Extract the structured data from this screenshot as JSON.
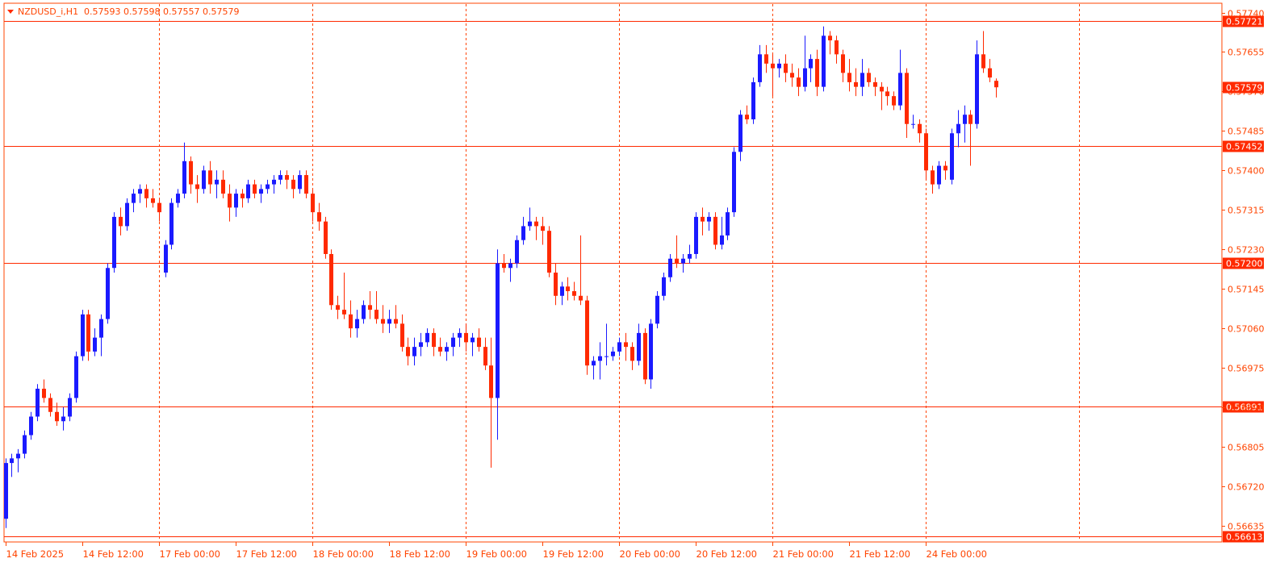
{
  "header": {
    "symbol_timeframe": "NZDUSD_i,H1",
    "ohlc": "0.57593 0.57598 0.57557 0.57579"
  },
  "colors": {
    "background": "#ffffff",
    "frame": "#ff4400",
    "bull": "#1a1aff",
    "bear": "#ff2a00",
    "level_line": "#ff2a00",
    "separator": "#ff4400",
    "tag_bg": "#ff2a00",
    "tag_text": "#ffffff",
    "axis_text": "#ff4400"
  },
  "chart_data": {
    "type": "candlestick",
    "symbol": "NZDUSD_i",
    "timeframe": "H1",
    "ylim": [
      0.566,
      0.5776
    ],
    "y_ticks": [
      "0.57740",
      "0.57655",
      "0.57570",
      "0.57485",
      "0.57400",
      "0.57315",
      "0.57230",
      "0.57145",
      "0.57060",
      "0.56975",
      "0.56890",
      "0.56805",
      "0.56720",
      "0.56635"
    ],
    "x_tick_labels": [
      {
        "label": "14 Feb 2025",
        "bar": 0
      },
      {
        "label": "14 Feb 12:00",
        "bar": 12
      },
      {
        "label": "17 Feb 00:00",
        "bar": 24
      },
      {
        "label": "17 Feb 12:00",
        "bar": 36
      },
      {
        "label": "18 Feb 00:00",
        "bar": 48
      },
      {
        "label": "18 Feb 12:00",
        "bar": 60
      },
      {
        "label": "19 Feb 00:00",
        "bar": 72
      },
      {
        "label": "19 Feb 12:00",
        "bar": 84
      },
      {
        "label": "20 Feb 00:00",
        "bar": 96
      },
      {
        "label": "20 Feb 12:00",
        "bar": 108
      },
      {
        "label": "21 Feb 00:00",
        "bar": 120
      },
      {
        "label": "21 Feb 12:00",
        "bar": 132
      },
      {
        "label": "24 Feb 00:00",
        "bar": 144
      }
    ],
    "day_separators": [
      24,
      48,
      72,
      96,
      120,
      144,
      168
    ],
    "horizontal_levels": [
      {
        "price": 0.57721,
        "label": "0.57721"
      },
      {
        "price": 0.57452,
        "label": "0.57452"
      },
      {
        "price": 0.572,
        "label": "0.57200"
      },
      {
        "price": 0.56891,
        "label": "0.56891"
      },
      {
        "price": 0.56613,
        "label": "0.56613"
      }
    ],
    "current_price": {
      "price": 0.57579,
      "label": "0.57579"
    },
    "candles": [
      [
        0.5665,
        0.5678,
        0.5663,
        0.5677
      ],
      [
        0.5677,
        0.5679,
        0.5674,
        0.5678
      ],
      [
        0.5678,
        0.568,
        0.5675,
        0.5679
      ],
      [
        0.5679,
        0.5684,
        0.5678,
        0.5683
      ],
      [
        0.5683,
        0.5688,
        0.5682,
        0.5687
      ],
      [
        0.5687,
        0.5694,
        0.5686,
        0.5693
      ],
      [
        0.5693,
        0.5695,
        0.569,
        0.5691
      ],
      [
        0.5691,
        0.5692,
        0.5687,
        0.5688
      ],
      [
        0.5688,
        0.569,
        0.5685,
        0.5686
      ],
      [
        0.5686,
        0.5689,
        0.5684,
        0.5687
      ],
      [
        0.5687,
        0.5692,
        0.5686,
        0.5691
      ],
      [
        0.5691,
        0.5701,
        0.569,
        0.57
      ],
      [
        0.57,
        0.571,
        0.5699,
        0.5709
      ],
      [
        0.5709,
        0.571,
        0.5699,
        0.5701
      ],
      [
        0.5701,
        0.5706,
        0.57,
        0.5704
      ],
      [
        0.5704,
        0.5709,
        0.57,
        0.5708
      ],
      [
        0.5708,
        0.572,
        0.5707,
        0.5719
      ],
      [
        0.5719,
        0.5731,
        0.5718,
        0.573
      ],
      [
        0.573,
        0.5732,
        0.5726,
        0.5728
      ],
      [
        0.5728,
        0.5734,
        0.5727,
        0.5733
      ],
      [
        0.5733,
        0.5736,
        0.5731,
        0.5735
      ],
      [
        0.5735,
        0.5737,
        0.5733,
        0.5736
      ],
      [
        0.5736,
        0.5737,
        0.5732,
        0.5734
      ],
      [
        0.5734,
        0.5736,
        0.5732,
        0.5733
      ],
      [
        0.5733,
        0.5734,
        0.5729,
        0.5731
      ],
      [
        0.5718,
        0.5725,
        0.5717,
        0.5724
      ],
      [
        0.5724,
        0.5734,
        0.5723,
        0.5733
      ],
      [
        0.5733,
        0.5736,
        0.5732,
        0.5735
      ],
      [
        0.5735,
        0.5746,
        0.5734,
        0.5742
      ],
      [
        0.5742,
        0.5743,
        0.5735,
        0.5737
      ],
      [
        0.5737,
        0.5739,
        0.5733,
        0.5736
      ],
      [
        0.5736,
        0.5741,
        0.5735,
        0.574
      ],
      [
        0.574,
        0.5742,
        0.5735,
        0.5737
      ],
      [
        0.5737,
        0.574,
        0.5734,
        0.5738
      ],
      [
        0.5738,
        0.574,
        0.5734,
        0.5735
      ],
      [
        0.5735,
        0.5737,
        0.5729,
        0.5732
      ],
      [
        0.5732,
        0.5736,
        0.573,
        0.5735
      ],
      [
        0.5735,
        0.5736,
        0.5732,
        0.5734
      ],
      [
        0.5734,
        0.5738,
        0.5733,
        0.5737
      ],
      [
        0.5737,
        0.5738,
        0.5734,
        0.5735
      ],
      [
        0.5735,
        0.5737,
        0.5733,
        0.5736
      ],
      [
        0.5736,
        0.5738,
        0.5735,
        0.5737
      ],
      [
        0.5737,
        0.5739,
        0.5735,
        0.5738
      ],
      [
        0.5738,
        0.574,
        0.5737,
        0.5739
      ],
      [
        0.5739,
        0.574,
        0.5736,
        0.5738
      ],
      [
        0.5738,
        0.5739,
        0.5734,
        0.5736
      ],
      [
        0.5736,
        0.574,
        0.5735,
        0.5739
      ],
      [
        0.5739,
        0.574,
        0.5734,
        0.5735
      ],
      [
        0.5735,
        0.5736,
        0.5729,
        0.5731
      ],
      [
        0.5731,
        0.5733,
        0.5727,
        0.5729
      ],
      [
        0.5729,
        0.573,
        0.5721,
        0.5722
      ],
      [
        0.5722,
        0.5723,
        0.571,
        0.5711
      ],
      [
        0.5711,
        0.5713,
        0.5708,
        0.571
      ],
      [
        0.571,
        0.5718,
        0.5708,
        0.5709
      ],
      [
        0.5709,
        0.5712,
        0.5704,
        0.5706
      ],
      [
        0.5706,
        0.571,
        0.5704,
        0.5708
      ],
      [
        0.5708,
        0.5712,
        0.5707,
        0.5711
      ],
      [
        0.5711,
        0.5714,
        0.5708,
        0.571
      ],
      [
        0.571,
        0.5714,
        0.5707,
        0.5708
      ],
      [
        0.5708,
        0.5711,
        0.5705,
        0.5707
      ],
      [
        0.5707,
        0.571,
        0.5705,
        0.5708
      ],
      [
        0.5708,
        0.5711,
        0.5706,
        0.5707
      ],
      [
        0.5707,
        0.5709,
        0.5701,
        0.5702
      ],
      [
        0.5702,
        0.5704,
        0.5698,
        0.57
      ],
      [
        0.57,
        0.5704,
        0.5698,
        0.5702
      ],
      [
        0.5702,
        0.5705,
        0.57,
        0.5703
      ],
      [
        0.5703,
        0.5706,
        0.5702,
        0.5705
      ],
      [
        0.5705,
        0.5706,
        0.57,
        0.5702
      ],
      [
        0.5702,
        0.5704,
        0.57,
        0.5701
      ],
      [
        0.5701,
        0.5703,
        0.5699,
        0.5702
      ],
      [
        0.5702,
        0.5705,
        0.57,
        0.5704
      ],
      [
        0.5704,
        0.5706,
        0.5702,
        0.5705
      ],
      [
        0.5705,
        0.5707,
        0.5701,
        0.5703
      ],
      [
        0.5703,
        0.5705,
        0.57,
        0.5704
      ],
      [
        0.5704,
        0.5706,
        0.5701,
        0.5702
      ],
      [
        0.5702,
        0.5704,
        0.5697,
        0.5698
      ],
      [
        0.5698,
        0.5704,
        0.5676,
        0.5691
      ],
      [
        0.5691,
        0.5723,
        0.5682,
        0.572
      ],
      [
        0.572,
        0.5722,
        0.5718,
        0.5719
      ],
      [
        0.5719,
        0.5721,
        0.5716,
        0.572
      ],
      [
        0.572,
        0.5726,
        0.5719,
        0.5725
      ],
      [
        0.5725,
        0.573,
        0.5724,
        0.5728
      ],
      [
        0.5728,
        0.5732,
        0.5727,
        0.5729
      ],
      [
        0.5729,
        0.573,
        0.5725,
        0.5728
      ],
      [
        0.5728,
        0.573,
        0.5724,
        0.5727
      ],
      [
        0.5727,
        0.5728,
        0.5717,
        0.5718
      ],
      [
        0.5718,
        0.572,
        0.5711,
        0.5713
      ],
      [
        0.5713,
        0.5716,
        0.5711,
        0.5715
      ],
      [
        0.5715,
        0.5717,
        0.5712,
        0.5714
      ],
      [
        0.5714,
        0.5716,
        0.5712,
        0.5713
      ],
      [
        0.5713,
        0.5726,
        0.5711,
        0.5712
      ],
      [
        0.5712,
        0.5713,
        0.5696,
        0.5698
      ],
      [
        0.5698,
        0.57,
        0.5695,
        0.5699
      ],
      [
        0.5699,
        0.5703,
        0.5695,
        0.57
      ],
      [
        0.57,
        0.5707,
        0.5698,
        0.57
      ],
      [
        0.57,
        0.5702,
        0.5699,
        0.5701
      ],
      [
        0.5701,
        0.5704,
        0.57,
        0.5703
      ],
      [
        0.5703,
        0.5705,
        0.5699,
        0.5702
      ],
      [
        0.5702,
        0.5703,
        0.5697,
        0.5699
      ],
      [
        0.5699,
        0.5707,
        0.5698,
        0.5705
      ],
      [
        0.5705,
        0.5706,
        0.5694,
        0.5695
      ],
      [
        0.5695,
        0.5708,
        0.5693,
        0.5707
      ],
      [
        0.5707,
        0.5714,
        0.5706,
        0.5713
      ],
      [
        0.5713,
        0.5718,
        0.5712,
        0.5717
      ],
      [
        0.5717,
        0.5722,
        0.5716,
        0.5721
      ],
      [
        0.5721,
        0.5726,
        0.5719,
        0.572
      ],
      [
        0.572,
        0.5722,
        0.5718,
        0.5721
      ],
      [
        0.5721,
        0.5724,
        0.572,
        0.5722
      ],
      [
        0.5722,
        0.5731,
        0.5721,
        0.573
      ],
      [
        0.573,
        0.5732,
        0.5726,
        0.5729
      ],
      [
        0.5729,
        0.5731,
        0.5727,
        0.573
      ],
      [
        0.573,
        0.5731,
        0.5723,
        0.5724
      ],
      [
        0.5724,
        0.573,
        0.5723,
        0.5726
      ],
      [
        0.5726,
        0.5732,
        0.5725,
        0.5731
      ],
      [
        0.5731,
        0.5745,
        0.573,
        0.5744
      ],
      [
        0.5744,
        0.5753,
        0.5742,
        0.5752
      ],
      [
        0.5752,
        0.5754,
        0.575,
        0.5751
      ],
      [
        0.5751,
        0.576,
        0.575,
        0.5759
      ],
      [
        0.5759,
        0.5767,
        0.5758,
        0.5765
      ],
      [
        0.5765,
        0.5767,
        0.5761,
        0.5763
      ],
      [
        0.5763,
        0.5765,
        0.5756,
        0.5762
      ],
      [
        0.5762,
        0.5764,
        0.576,
        0.5763
      ],
      [
        0.5763,
        0.5765,
        0.5759,
        0.5761
      ],
      [
        0.5761,
        0.5763,
        0.5758,
        0.576
      ],
      [
        0.576,
        0.5762,
        0.5756,
        0.5758
      ],
      [
        0.5758,
        0.5769,
        0.5757,
        0.5762
      ],
      [
        0.5762,
        0.5765,
        0.5759,
        0.5764
      ],
      [
        0.5764,
        0.5766,
        0.5756,
        0.5758
      ],
      [
        0.5758,
        0.5771,
        0.5757,
        0.5769
      ],
      [
        0.5769,
        0.577,
        0.5765,
        0.5768
      ],
      [
        0.5768,
        0.5769,
        0.5763,
        0.5765
      ],
      [
        0.5765,
        0.5766,
        0.5759,
        0.5761
      ],
      [
        0.5761,
        0.5764,
        0.5757,
        0.5759
      ],
      [
        0.5759,
        0.5762,
        0.5756,
        0.5758
      ],
      [
        0.5758,
        0.5764,
        0.5756,
        0.5761
      ],
      [
        0.5761,
        0.5762,
        0.5758,
        0.5759
      ],
      [
        0.5759,
        0.576,
        0.5756,
        0.5758
      ],
      [
        0.5758,
        0.5759,
        0.5753,
        0.5757
      ],
      [
        0.5757,
        0.5758,
        0.5754,
        0.5756
      ],
      [
        0.5756,
        0.5757,
        0.5753,
        0.5754
      ],
      [
        0.5754,
        0.5766,
        0.5753,
        0.5761
      ],
      [
        0.5761,
        0.5762,
        0.5747,
        0.575
      ],
      [
        0.575,
        0.5752,
        0.5749,
        0.575
      ],
      [
        0.575,
        0.5751,
        0.5746,
        0.5748
      ],
      [
        0.5748,
        0.5749,
        0.5738,
        0.574
      ],
      [
        0.574,
        0.5741,
        0.5735,
        0.5737
      ],
      [
        0.5737,
        0.5742,
        0.5736,
        0.5741
      ],
      [
        0.5741,
        0.5742,
        0.5738,
        0.574
      ],
      [
        0.5738,
        0.5749,
        0.5737,
        0.5748
      ],
      [
        0.5748,
        0.5753,
        0.5745,
        0.575
      ],
      [
        0.575,
        0.5754,
        0.5746,
        0.5752
      ],
      [
        0.5752,
        0.5753,
        0.5741,
        0.575
      ],
      [
        0.575,
        0.5768,
        0.5749,
        0.5765
      ],
      [
        0.5765,
        0.577,
        0.5761,
        0.5762
      ],
      [
        0.5762,
        0.5764,
        0.5759,
        0.576
      ],
      [
        0.57593,
        0.57598,
        0.57557,
        0.57579
      ]
    ]
  }
}
